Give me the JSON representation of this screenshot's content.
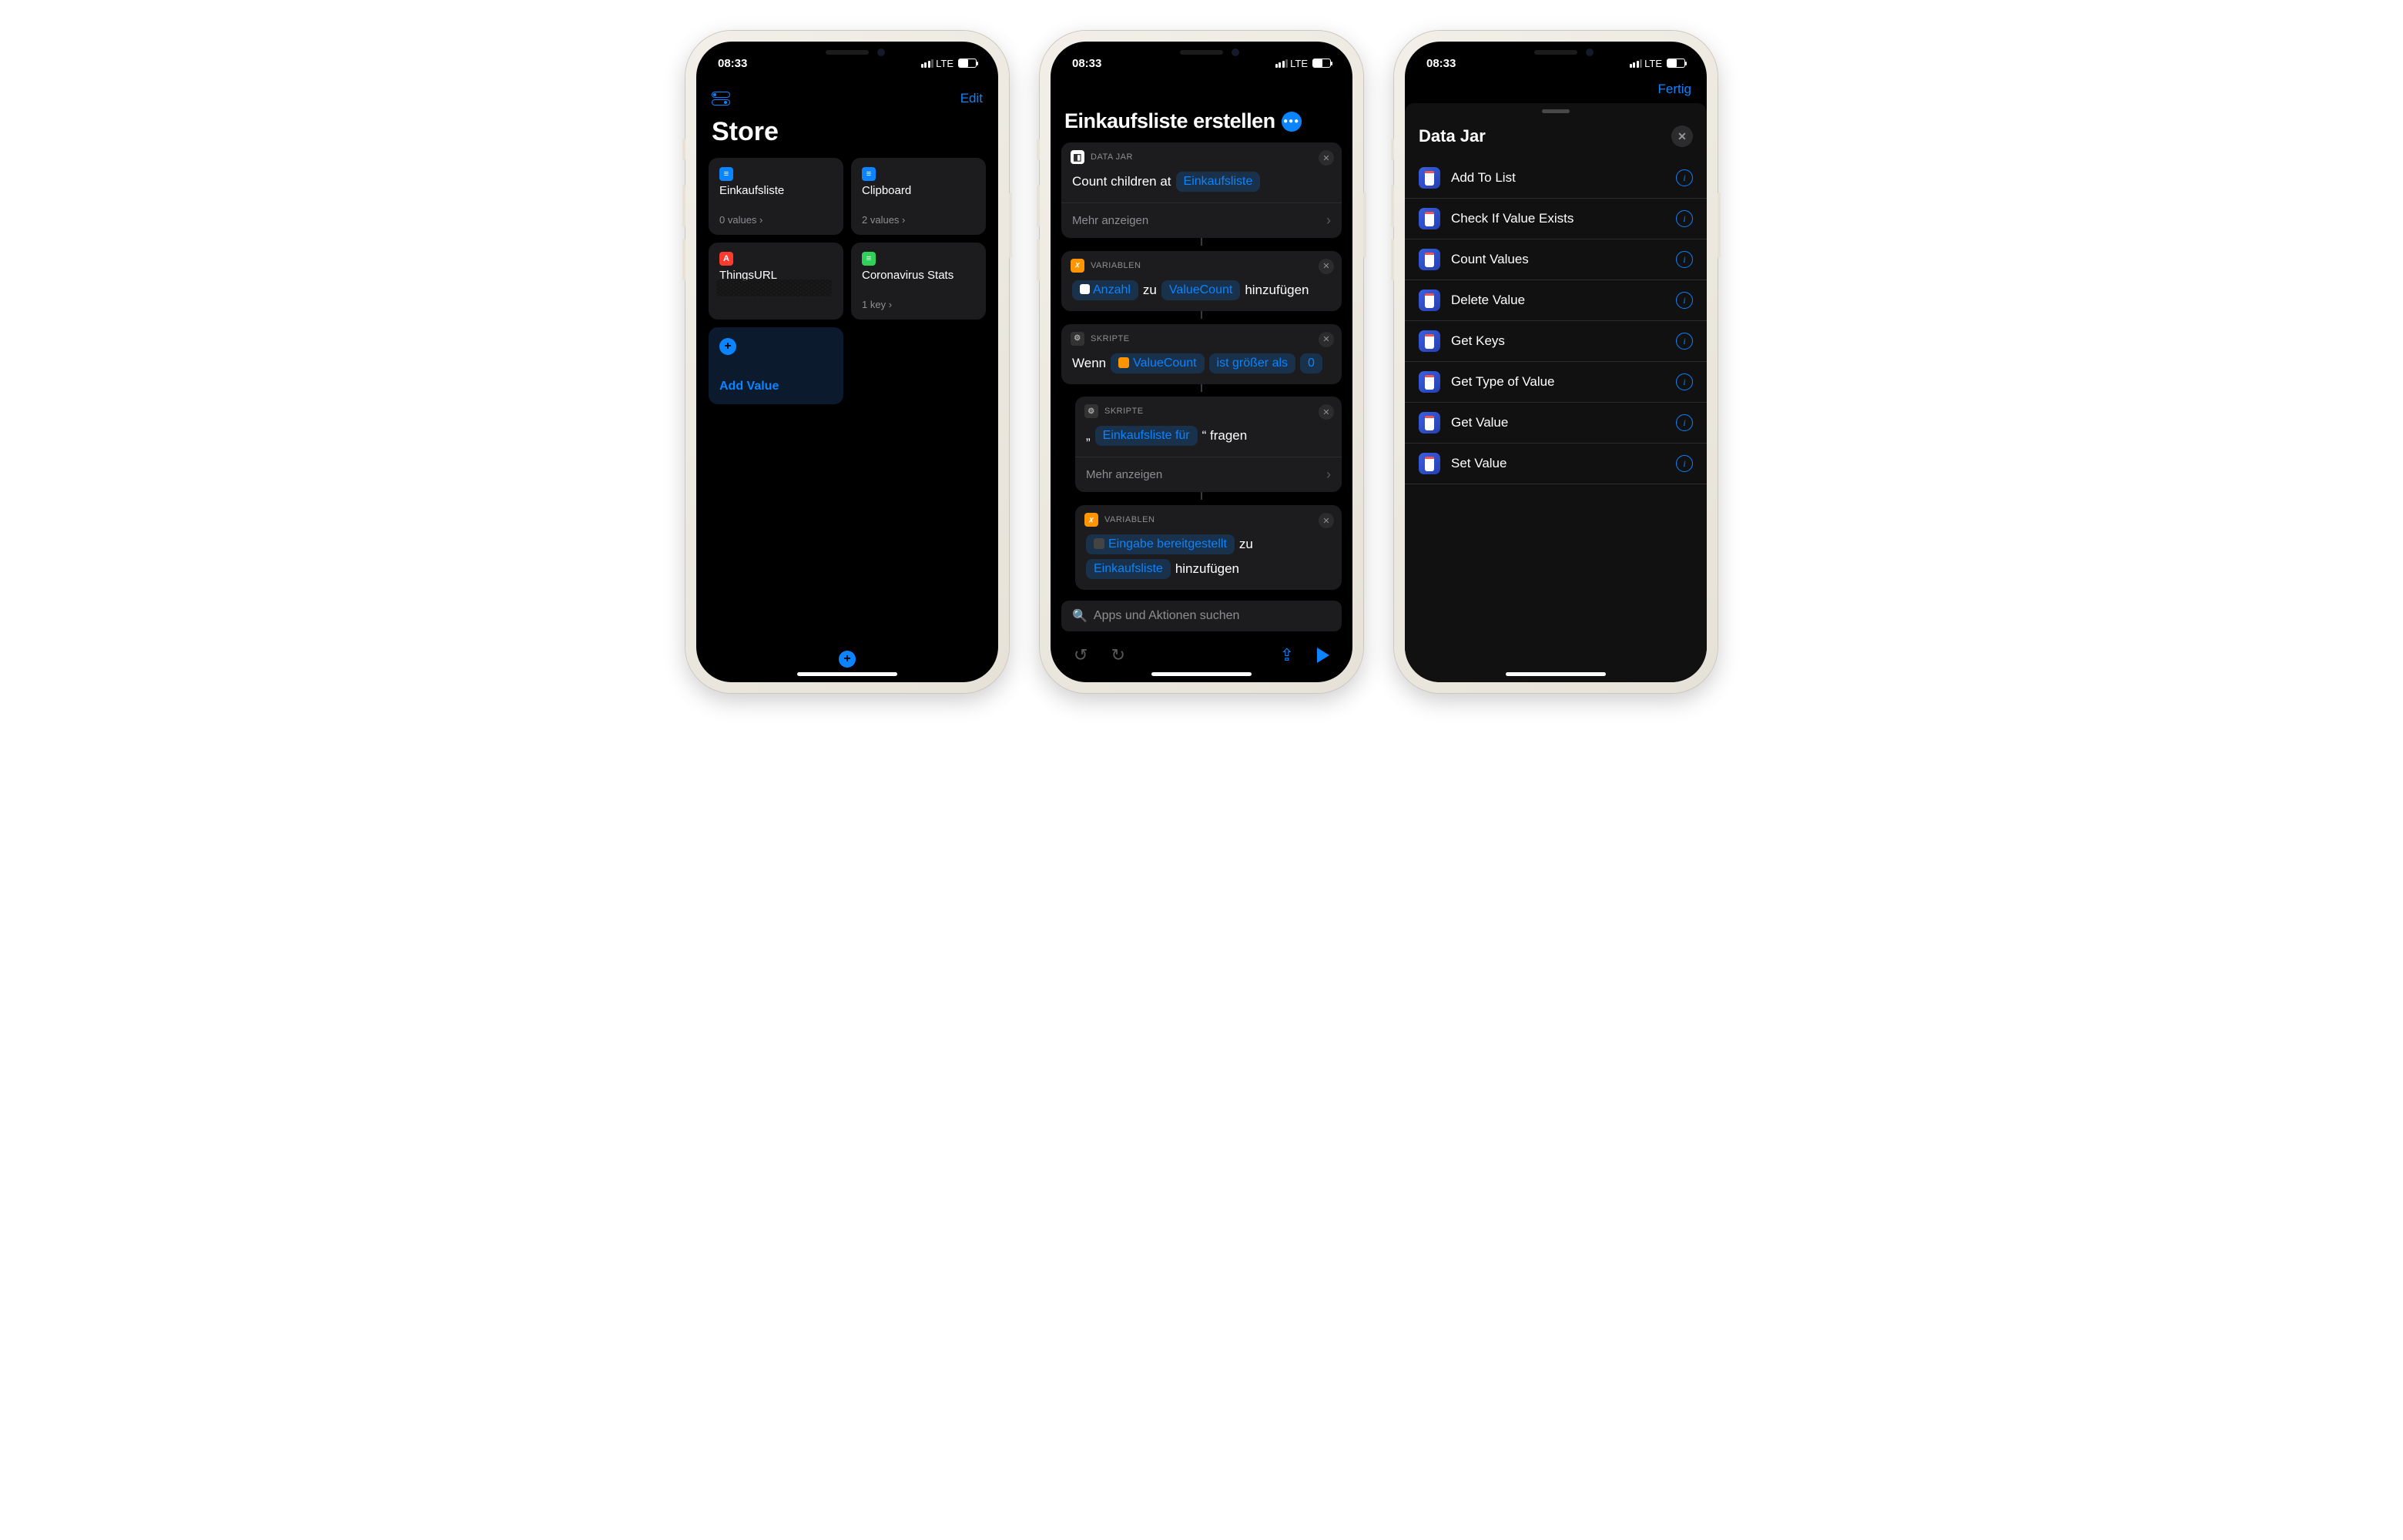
{
  "status": {
    "time": "08:33",
    "carrier": "LTE"
  },
  "phone1": {
    "edit": "Edit",
    "title": "Store",
    "cards": [
      {
        "name": "Einkaufsliste",
        "meta": "0 values",
        "icon": "blue"
      },
      {
        "name": "Clipboard",
        "meta": "2 values",
        "icon": "blue"
      },
      {
        "name": "ThingsURL",
        "meta": "",
        "icon": "red"
      },
      {
        "name": "Coronavirus Stats",
        "meta": "1 key",
        "icon": "green"
      }
    ],
    "add": "Add Value"
  },
  "phone2": {
    "done": "Fertig",
    "title": "Einkaufsliste erstellen",
    "blocks": {
      "b1": {
        "app": "DATA JAR",
        "pre": "Count children at",
        "t1": "Einkaufsliste",
        "more": "Mehr anzeigen"
      },
      "b2": {
        "app": "VARIABLEN",
        "t1": "Anzahl",
        "mid": "zu",
        "t2": "ValueCount",
        "post": "hinzufügen"
      },
      "b3": {
        "app": "SKRIPTE",
        "pre": "Wenn",
        "t1": "ValueCount",
        "t2": "ist größer als",
        "t3": "0"
      },
      "b4": {
        "app": "SKRIPTE",
        "q1": "„",
        "t1": "Einkaufsliste für",
        "q2": "“ fragen",
        "more": "Mehr anzeigen"
      },
      "b5": {
        "app": "VARIABLEN",
        "t1": "Eingabe bereitgestellt",
        "mid": "zu",
        "t2": "Einkaufsliste",
        "post": "hinzufügen"
      }
    },
    "search": "Apps und Aktionen suchen"
  },
  "phone3": {
    "done": "Fertig",
    "title": "Data Jar",
    "rows": [
      "Add To List",
      "Check If Value Exists",
      "Count Values",
      "Delete Value",
      "Get Keys",
      "Get Type of Value",
      "Get Value",
      "Set Value"
    ]
  }
}
